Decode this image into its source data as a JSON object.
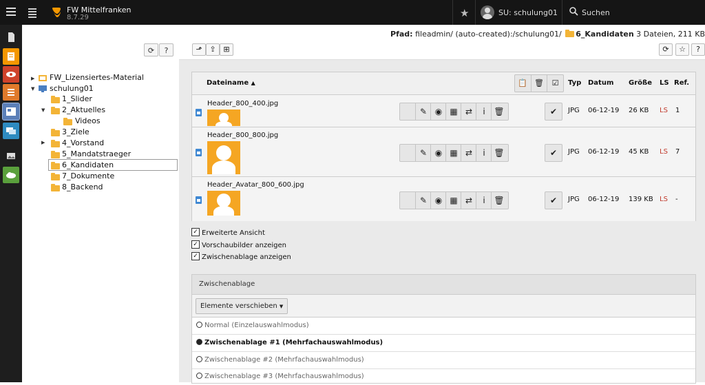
{
  "topbar": {
    "site_title": "FW Mittelfranken",
    "version": "8.7.29",
    "user": "SU: schulung01",
    "search": "Suchen"
  },
  "tree": {
    "nodes": [
      {
        "label": "FW_Lizensiertes-Material"
      },
      {
        "label": "schulung01"
      },
      {
        "label": "1_Slider"
      },
      {
        "label": "2_Aktuelles"
      },
      {
        "label": "Videos"
      },
      {
        "label": "3_Ziele"
      },
      {
        "label": "4_Vorstand"
      },
      {
        "label": "5_Mandatstraeger"
      },
      {
        "label": "6_Kandidaten"
      },
      {
        "label": "7_Dokumente"
      },
      {
        "label": "8_Backend"
      }
    ]
  },
  "path": {
    "label": "Pfad:",
    "value": "fileadmin/ (auto-created):/schulung01/",
    "folder": "6_Kandidaten",
    "count": "3 Dateien, 211 KB"
  },
  "table": {
    "headers": {
      "name": "Dateiname",
      "type": "Typ",
      "date": "Datum",
      "size": "Größe",
      "ls": "LS",
      "ref": "Ref."
    },
    "rows": [
      {
        "name": "Header_800_400.jpg",
        "type": "JPG",
        "date": "06-12-19",
        "size": "26 KB",
        "ls": "LS",
        "ref": "1"
      },
      {
        "name": "Header_800_800.jpg",
        "type": "JPG",
        "date": "06-12-19",
        "size": "45 KB",
        "ls": "LS",
        "ref": "7"
      },
      {
        "name": "Header_Avatar_800_600.jpg",
        "type": "JPG",
        "date": "06-12-19",
        "size": "139 KB",
        "ls": "LS",
        "ref": "-"
      }
    ]
  },
  "options": {
    "extended_view": "Erweiterte Ansicht",
    "show_thumbnails": "Vorschaubilder anzeigen",
    "show_clipboard": "Zwischenablage anzeigen"
  },
  "clipboard": {
    "title": "Zwischenablage",
    "action": "Elemente verschieben",
    "rows": [
      {
        "label": "Normal (Einzelauswahlmodus)",
        "active": false
      },
      {
        "label": "Zwischenablage #1 (Mehrfachauswahlmodus)",
        "active": true
      },
      {
        "label": "Zwischenablage #2 (Mehrfachauswahlmodus)",
        "active": false
      },
      {
        "label": "Zwischenablage #3 (Mehrfachauswahlmodus)",
        "active": false
      }
    ]
  },
  "colors": {
    "topbar": "#151515",
    "accent": "#f49700",
    "ls_red": "#c0392b",
    "folder": "#f3b437"
  }
}
